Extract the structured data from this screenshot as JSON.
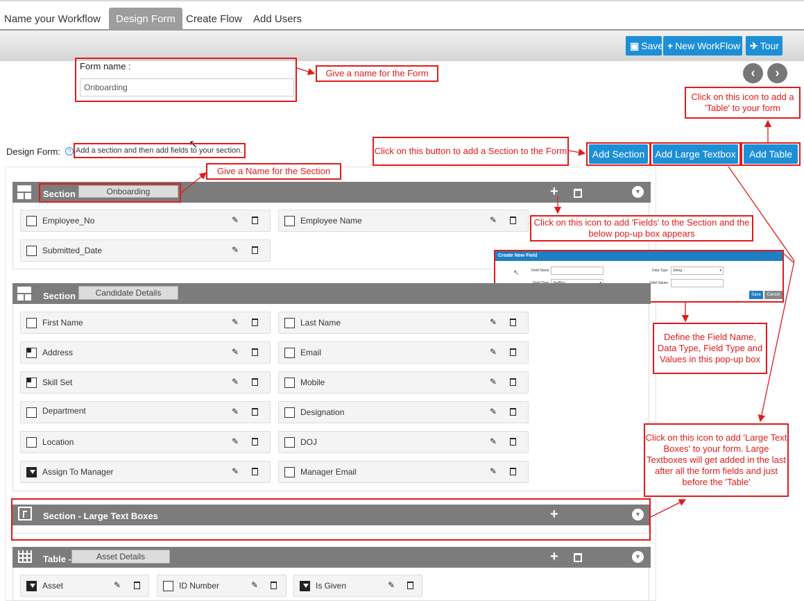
{
  "tabs": [
    "Name your Workflow",
    "Design Form",
    "Create Flow",
    "Add Users"
  ],
  "toolbar": {
    "save": "Save",
    "new_workflow": "New WorkFlow",
    "tour": "Tour"
  },
  "form": {
    "label": "Form name :",
    "value": "Onboarding"
  },
  "design_form": {
    "label": "Design Form:",
    "hint": "Add a section and then add fields to your section."
  },
  "buttons": {
    "add_section": "Add Section",
    "add_large_textbox": "Add Large Textbox",
    "add_table": "Add Table"
  },
  "sections": [
    {
      "title": "Section -",
      "name": "Onboarding",
      "fields": [
        "Employee_No",
        "Employee Name",
        "Submitted_Date"
      ]
    },
    {
      "title": "Section -",
      "name": "Candidate Details",
      "fields": [
        "First Name",
        "Last Name",
        "Address",
        "Email",
        "Skill Set",
        "Mobile",
        "Department",
        "Designation",
        "Location",
        "DOJ",
        "Assign To Manager",
        "Manager Email"
      ]
    },
    {
      "title": "Section - Large Text Boxes"
    },
    {
      "title": "Table -",
      "name": "Asset Details",
      "fields": [
        "Asset",
        "ID Number",
        "Is Given"
      ]
    }
  ],
  "popup": {
    "title": "Create New Field",
    "field_name": "Field Name",
    "field_type": "Field Type",
    "field_type_value": "TextBox",
    "data_type": "Data Type",
    "data_type_value": "String",
    "valid_values": "Valid Values",
    "save": "Save",
    "cancel": "Cancel"
  },
  "callouts": {
    "form_name": "Give a name for the Form",
    "table": "Click on this icon to add a 'Table' to your form",
    "add_section": "Click on this button to add a Section to the Form",
    "section_name": "Give a Name for the Section",
    "fields": "Click on this icon to add 'Fields' to the Section and the below pop-up box appears",
    "define": "Define the Field Name, Data Type, Field Type and Values in this pop-up box",
    "large_text": "Click on this icon to add 'Large Text Boxes' to your form. Large Textboxes will get added in the last after all the form fields and just before the 'Table'"
  },
  "colors": {
    "accent": "#1d8fd6",
    "annotation": "#e21a1a",
    "section_bar": "#7c7c7c"
  }
}
